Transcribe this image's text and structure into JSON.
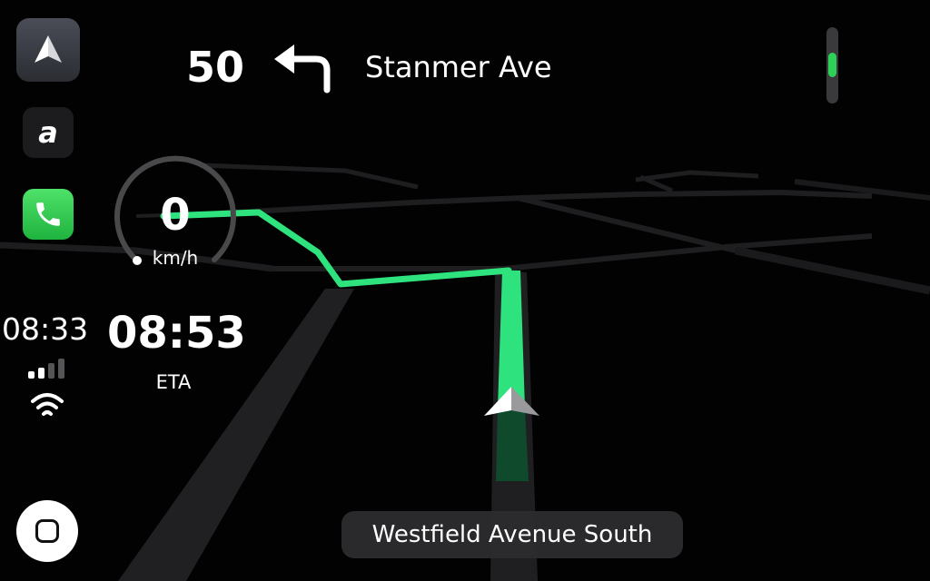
{
  "navigation": {
    "turn_distance": "50",
    "turn_direction": "left",
    "next_street": "Stanmer Ave",
    "current_street": "Westfield Avenue South"
  },
  "speed": {
    "value": "0",
    "unit": "km/h"
  },
  "eta": {
    "time": "08:53",
    "label": "ETA"
  },
  "status": {
    "clock": "08:33",
    "signal_bars_active": 2,
    "signal_bars_total": 4,
    "wifi": "connected"
  },
  "sidebar": {
    "apps": [
      {
        "name": "navigation-app",
        "icon": "navigation-arrow-icon"
      },
      {
        "name": "audio-app",
        "icon": "letter-a-icon"
      },
      {
        "name": "phone-app",
        "icon": "phone-icon"
      }
    ],
    "home_icon": "home-square-icon"
  },
  "volume": {
    "level": 0.35
  },
  "colors": {
    "route": "#2ee27e",
    "background": "#020202",
    "road": "#1d1d1f",
    "volume_accent": "#2ed158",
    "phone_green": "#30c94c"
  }
}
